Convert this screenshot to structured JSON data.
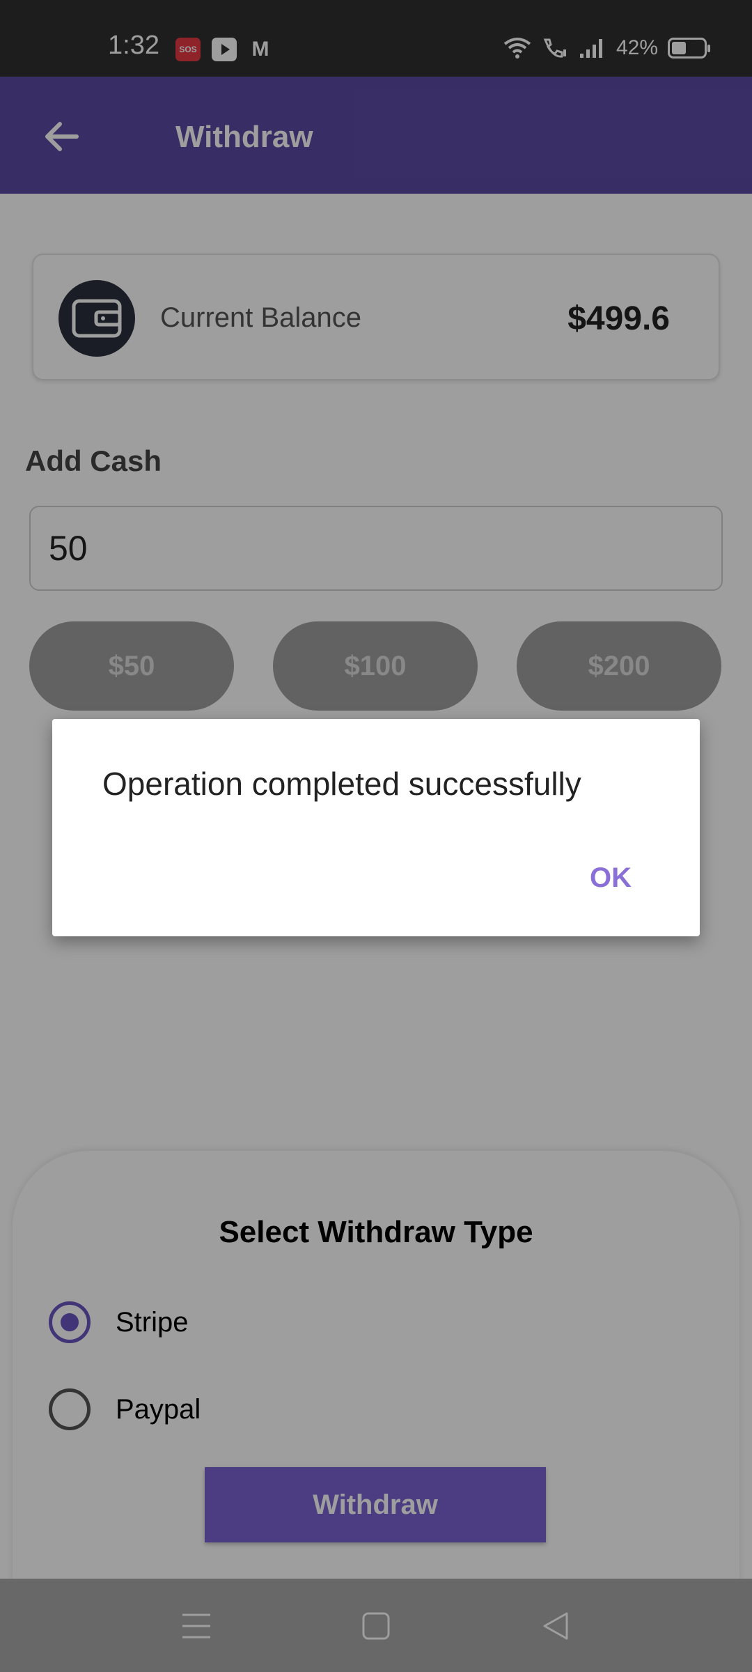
{
  "status_bar": {
    "time": "1:32",
    "sos_label": "SOS",
    "gmail_label": "M",
    "battery_percent": "42%",
    "battery_level": 0.42
  },
  "app_bar": {
    "title": "Withdraw",
    "back_icon": "arrow-left-icon",
    "background_color": "#5c4aa5"
  },
  "balance_card": {
    "label": "Current Balance",
    "value": "$499.6",
    "icon": "wallet-icon"
  },
  "add_cash": {
    "label": "Add Cash",
    "input_value": "50",
    "quick_amounts": [
      "$50",
      "$100",
      "$200"
    ]
  },
  "withdraw_sheet": {
    "title": "Select Withdraw Type",
    "options": [
      {
        "label": "Stripe",
        "selected": true
      },
      {
        "label": "Paypal",
        "selected": false
      }
    ],
    "button_label": "Withdraw",
    "accent_color": "#6a54c0"
  },
  "dialog": {
    "message": "Operation completed successfully",
    "ok_label": "OK",
    "ok_color": "#8a6fd6"
  },
  "nav_bar": {
    "icons": [
      "menu-icon",
      "home-square-icon",
      "back-triangle-icon"
    ]
  }
}
